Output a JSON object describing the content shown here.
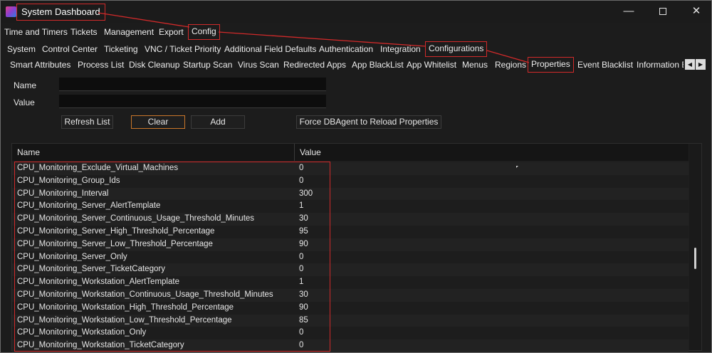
{
  "window": {
    "title": "System Dashboard",
    "controls": {
      "minimize": "—",
      "maximize": "",
      "close": "✕"
    }
  },
  "main_tabs": [
    {
      "label": "Time and Timers"
    },
    {
      "label": "Tickets"
    },
    {
      "label": "Management"
    },
    {
      "label": "Export"
    },
    {
      "label": "Config"
    }
  ],
  "config_tabs": [
    {
      "label": "System"
    },
    {
      "label": "Control Center"
    },
    {
      "label": "Ticketing"
    },
    {
      "label": "VNC / Ticket Priority"
    },
    {
      "label": "Additional Field Defaults"
    },
    {
      "label": "Authentication"
    },
    {
      "label": "Integration"
    },
    {
      "label": "Configurations"
    }
  ],
  "configuration_tabs": [
    {
      "label": "Smart Attributes"
    },
    {
      "label": "Process List"
    },
    {
      "label": "Disk Cleanup"
    },
    {
      "label": "Startup Scan"
    },
    {
      "label": "Virus Scan"
    },
    {
      "label": "Redirected Apps"
    },
    {
      "label": "App BlackList"
    },
    {
      "label": "App Whitelist"
    },
    {
      "label": "Menus"
    },
    {
      "label": "Regions"
    },
    {
      "label": "Properties"
    },
    {
      "label": "Event Blacklist"
    },
    {
      "label": "Information E"
    }
  ],
  "tab_scroll": {
    "left": "◀",
    "right": "▶"
  },
  "form": {
    "name_label": "Name",
    "name_value": "",
    "value_label": "Value",
    "value_value": ""
  },
  "buttons": {
    "refresh": "Refresh List",
    "clear": "Clear",
    "add": "Add",
    "force_reload": "Force DBAgent to Reload Properties"
  },
  "grid": {
    "columns": {
      "name": "Name",
      "value": "Value"
    },
    "rows": [
      {
        "name": "CPU_Monitoring_Exclude_Virtual_Machines",
        "value": "0"
      },
      {
        "name": "CPU_Monitoring_Group_Ids",
        "value": "0"
      },
      {
        "name": "CPU_Monitoring_Interval",
        "value": "300"
      },
      {
        "name": "CPU_Monitoring_Server_AlertTemplate",
        "value": "1"
      },
      {
        "name": "CPU_Monitoring_Server_Continuous_Usage_Threshold_Minutes",
        "value": "30"
      },
      {
        "name": "CPU_Monitoring_Server_High_Threshold_Percentage",
        "value": "95"
      },
      {
        "name": "CPU_Monitoring_Server_Low_Threshold_Percentage",
        "value": "90"
      },
      {
        "name": "CPU_Monitoring_Server_Only",
        "value": "0"
      },
      {
        "name": "CPU_Monitoring_Server_TicketCategory",
        "value": "0"
      },
      {
        "name": "CPU_Monitoring_Workstation_AlertTemplate",
        "value": "1"
      },
      {
        "name": "CPU_Monitoring_Workstation_Continuous_Usage_Threshold_Minutes",
        "value": "30"
      },
      {
        "name": "CPU_Monitoring_Workstation_High_Threshold_Percentage",
        "value": "90"
      },
      {
        "name": "CPU_Monitoring_Workstation_Low_Threshold_Percentage",
        "value": "85"
      },
      {
        "name": "CPU_Monitoring_Workstation_Only",
        "value": "0"
      },
      {
        "name": "CPU_Monitoring_Workstation_TicketCategory",
        "value": "0"
      }
    ]
  },
  "colors": {
    "annotation": "#d12a2a",
    "focus_outline": "#c9762a",
    "background": "#1c1c1c"
  }
}
